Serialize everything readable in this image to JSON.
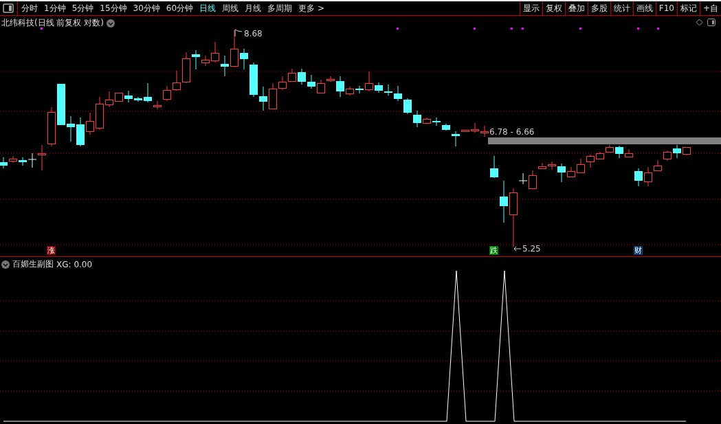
{
  "toolbar": {
    "periods": [
      {
        "label": "分时",
        "selected": false
      },
      {
        "label": "1分钟",
        "selected": false
      },
      {
        "label": "5分钟",
        "selected": false
      },
      {
        "label": "15分钟",
        "selected": false
      },
      {
        "label": "30分钟",
        "selected": false
      },
      {
        "label": "60分钟",
        "selected": false
      },
      {
        "label": "日线",
        "selected": true
      },
      {
        "label": "周线",
        "selected": false
      },
      {
        "label": "月线",
        "selected": false
      },
      {
        "label": "多周期",
        "selected": false
      },
      {
        "label": "更多 >",
        "selected": false
      }
    ],
    "buttons": [
      "显示",
      "复权",
      "叠加",
      "多股",
      "统计",
      "画线",
      "F10",
      "标记",
      "+自"
    ]
  },
  "main_chart": {
    "title": "北纬科技(日线 前复权 对数)",
    "price_labels": [
      {
        "kind": "high",
        "text": "8.68"
      },
      {
        "kind": "range",
        "text": "6.78 - 6.66"
      },
      {
        "kind": "low",
        "text": "5.25"
      }
    ],
    "markers": [
      {
        "text": "涨",
        "color": "#8b0000"
      },
      {
        "text": "跌",
        "color": "#008000"
      },
      {
        "text": "财",
        "color": "#0a3a6e"
      }
    ]
  },
  "sub_chart": {
    "title": "百媚生副图",
    "reading": "XG: 0.00"
  }
}
